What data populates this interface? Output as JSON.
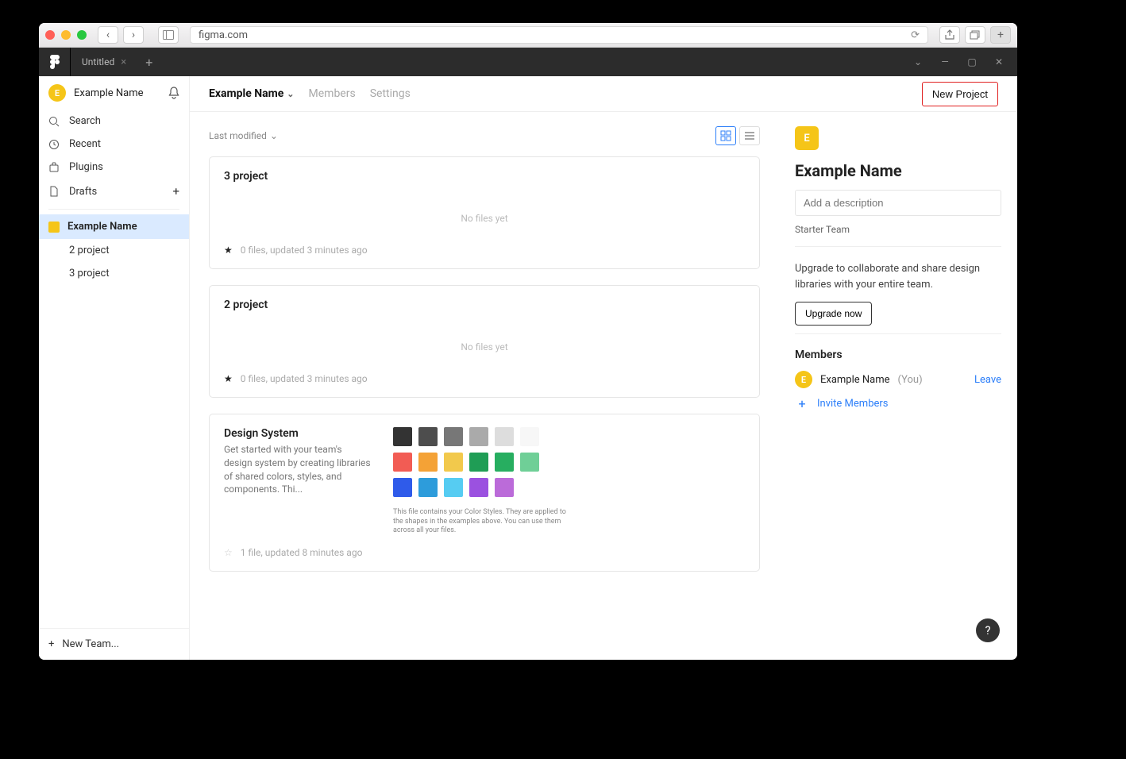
{
  "browser": {
    "url": "figma.com"
  },
  "appbar": {
    "tab_title": "Untitled"
  },
  "sidebar": {
    "user_initial": "E",
    "user_name": "Example Name",
    "nav": {
      "search": "Search",
      "recent": "Recent",
      "plugins": "Plugins",
      "drafts": "Drafts"
    },
    "team": {
      "name": "Example Name"
    },
    "projects": [
      "2 project",
      "3 project"
    ],
    "new_team": "New Team..."
  },
  "topbar": {
    "breadcrumb": "Example Name",
    "tabs": {
      "members": "Members",
      "settings": "Settings"
    },
    "new_project": "New Project"
  },
  "sort": {
    "label": "Last modified"
  },
  "cards": [
    {
      "title": "3 project",
      "nofiles": "No files yet",
      "meta": "0 files, updated 3 minutes ago",
      "starred": true
    },
    {
      "title": "2 project",
      "nofiles": "No files yet",
      "meta": "0 files, updated 3 minutes ago",
      "starred": true
    }
  ],
  "design_system": {
    "title": "Design System",
    "desc": "Get started with your team's design system by creating libraries of shared colors, styles, and components. Thi...",
    "meta": "1 file, updated 8 minutes ago",
    "caption": "This file contains your Color Styles. They are applied to the shapes in the examples above. You can use them across all your files.",
    "swatches_row1": [
      "#333333",
      "#4d4d4d",
      "#777777",
      "#aaaaaa",
      "#dddddd",
      "#f7f7f7"
    ],
    "swatches_row2": [
      "#f25c54",
      "#f4a236",
      "#f2c94c",
      "#1f9d55",
      "#27ae60",
      "#6fcf97"
    ],
    "swatches_row3": [
      "#2f5bea",
      "#2d9cdb",
      "#56ccf2",
      "#9b51e0",
      "#bb6bd9"
    ]
  },
  "panel": {
    "initial": "E",
    "name": "Example Name",
    "desc_placeholder": "Add a description",
    "plan": "Starter Team",
    "upgrade_text": "Upgrade to collaborate and share design libraries with your entire team.",
    "upgrade_btn": "Upgrade now",
    "members_heading": "Members",
    "member_name": "Example Name",
    "you": "(You)",
    "leave": "Leave",
    "invite": "Invite Members"
  },
  "help": "?"
}
